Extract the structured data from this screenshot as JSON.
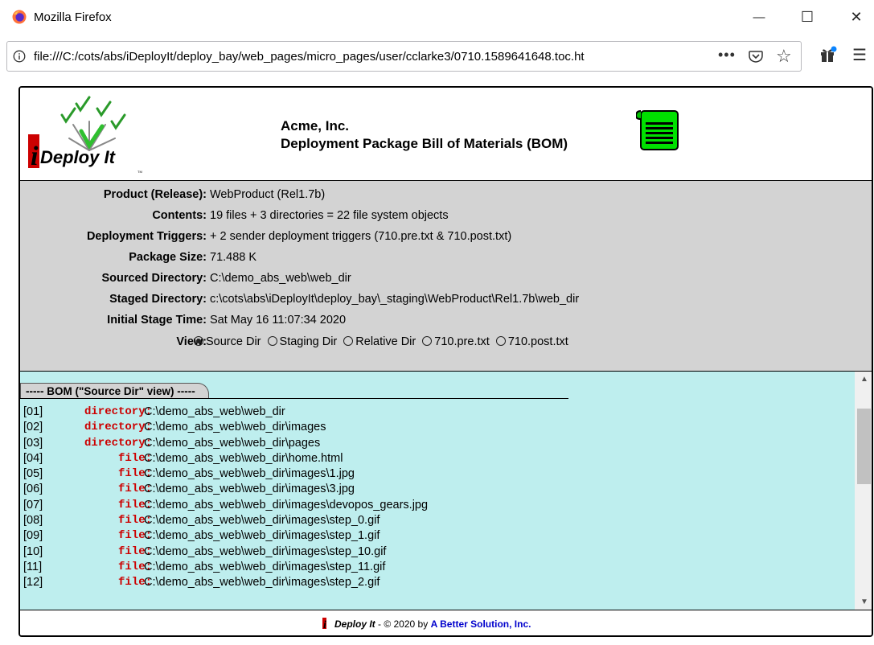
{
  "window": {
    "title": "Mozilla Firefox",
    "minimize": "—",
    "maximize": "☐",
    "close": "✕"
  },
  "address_bar": {
    "url": "file:///C:/cots/abs/iDeployIt/deploy_bay/web_pages/micro_pages/user/cclarke3/0710.1589641648.toc.ht",
    "more": "•••"
  },
  "header": {
    "logo_text": "Deploy It",
    "company": "Acme, Inc.",
    "title": "Deployment Package Bill of Materials (BOM)"
  },
  "info": {
    "product_label": "Product (Release):",
    "product_value": "WebProduct (Rel1.7b)",
    "contents_label": "Contents:",
    "contents_value": "19 files + 3 directories = 22 file system objects",
    "triggers_label": "Deployment Triggers:",
    "triggers_value": "+ 2 sender deployment triggers (710.pre.txt & 710.post.txt)",
    "size_label": "Package Size:",
    "size_value": "71.488 K",
    "sourced_label": "Sourced Directory:",
    "sourced_value": "C:\\demo_abs_web\\web_dir",
    "staged_label": "Staged Directory:",
    "staged_value": "c:\\cots\\abs\\iDeployIt\\deploy_bay\\_staging\\WebProduct\\Rel1.7b\\web_dir",
    "time_label": "Initial Stage Time:",
    "time_value": "Sat May 16 11:07:34 2020",
    "view_label": "View:",
    "view_options": [
      "Source Dir",
      "Staging Dir",
      "Relative Dir",
      "710.pre.txt",
      "710.post.txt"
    ],
    "view_selected": "Source Dir"
  },
  "bom": {
    "tab_label": "----- BOM (\"Source Dir\" view) -----",
    "items": [
      {
        "idx": "[01]",
        "kind": "directory:",
        "path": "C:\\demo_abs_web\\web_dir"
      },
      {
        "idx": "[02]",
        "kind": "directory:",
        "path": "C:\\demo_abs_web\\web_dir\\images"
      },
      {
        "idx": "[03]",
        "kind": "directory:",
        "path": "C:\\demo_abs_web\\web_dir\\pages"
      },
      {
        "idx": "[04]",
        "kind": "file:",
        "path": "C:\\demo_abs_web\\web_dir\\home.html"
      },
      {
        "idx": "[05]",
        "kind": "file:",
        "path": "C:\\demo_abs_web\\web_dir\\images\\1.jpg"
      },
      {
        "idx": "[06]",
        "kind": "file:",
        "path": "C:\\demo_abs_web\\web_dir\\images\\3.jpg"
      },
      {
        "idx": "[07]",
        "kind": "file:",
        "path": "C:\\demo_abs_web\\web_dir\\images\\devopos_gears.jpg"
      },
      {
        "idx": "[08]",
        "kind": "file:",
        "path": "C:\\demo_abs_web\\web_dir\\images\\step_0.gif"
      },
      {
        "idx": "[09]",
        "kind": "file:",
        "path": "C:\\demo_abs_web\\web_dir\\images\\step_1.gif"
      },
      {
        "idx": "[10]",
        "kind": "file:",
        "path": "C:\\demo_abs_web\\web_dir\\images\\step_10.gif"
      },
      {
        "idx": "[11]",
        "kind": "file:",
        "path": "C:\\demo_abs_web\\web_dir\\images\\step_11.gif"
      },
      {
        "idx": "[12]",
        "kind": "file:",
        "path": "C:\\demo_abs_web\\web_dir\\images\\step_2.gif"
      }
    ]
  },
  "footer": {
    "logo_text": "Deploy It",
    "copyright": " - © 2020 by ",
    "company": "A Better Solution, Inc."
  },
  "colors": {
    "info_bg": "#d3d3d3",
    "bom_bg": "#beeeee",
    "kind_text": "#cc0000",
    "brand_blue": "#0000cc"
  }
}
